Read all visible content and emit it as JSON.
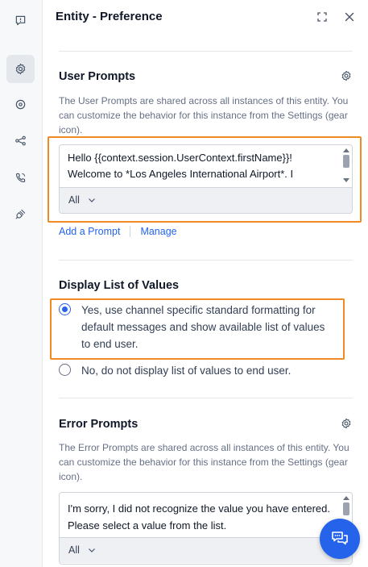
{
  "left_rail": {
    "items": [
      {
        "icon": "comment-alert-icon",
        "active": false
      },
      {
        "icon": "gear-icon",
        "active": true
      },
      {
        "icon": "target-icon",
        "active": false
      },
      {
        "icon": "share-nodes-icon",
        "active": false
      },
      {
        "icon": "phone-icon",
        "active": false
      },
      {
        "icon": "plug-icon",
        "active": false
      }
    ]
  },
  "header": {
    "title": "Entity - Preference",
    "expand_icon": "expand-icon",
    "close_icon": "close-icon"
  },
  "user_prompts": {
    "title": "User Prompts",
    "description": "The User Prompts are shared across all instances of this entity. You can customize the behavior for this instance from the Settings (gear icon).",
    "text_line1": "Hello {{context.session.UserContext.firstName}}!",
    "text_line2": "Welcome to *Los Angeles International Airport*. I",
    "channel": "All",
    "add_prompt_link": "Add a Prompt",
    "manage_link": "Manage"
  },
  "display_list": {
    "title": "Display List of Values",
    "option_yes": "Yes, use channel specific standard formatting for default messages and show available list of values to end user.",
    "option_no": "No, do not display list of values to end user.",
    "selected": "yes"
  },
  "error_prompts": {
    "title": "Error Prompts",
    "description": "The Error Prompts are shared across all instances of this entity. You can customize the behavior for this instance from the Settings (gear icon).",
    "text": "I'm sorry, I did not recognize the value you have entered. Please select a value from the list.",
    "channel": "All"
  },
  "colors": {
    "accent": "#2563eb",
    "highlight": "#f08a24",
    "rail_bg": "#f7f8fa"
  },
  "chat_fab_icon": "chat-bubbles-icon"
}
